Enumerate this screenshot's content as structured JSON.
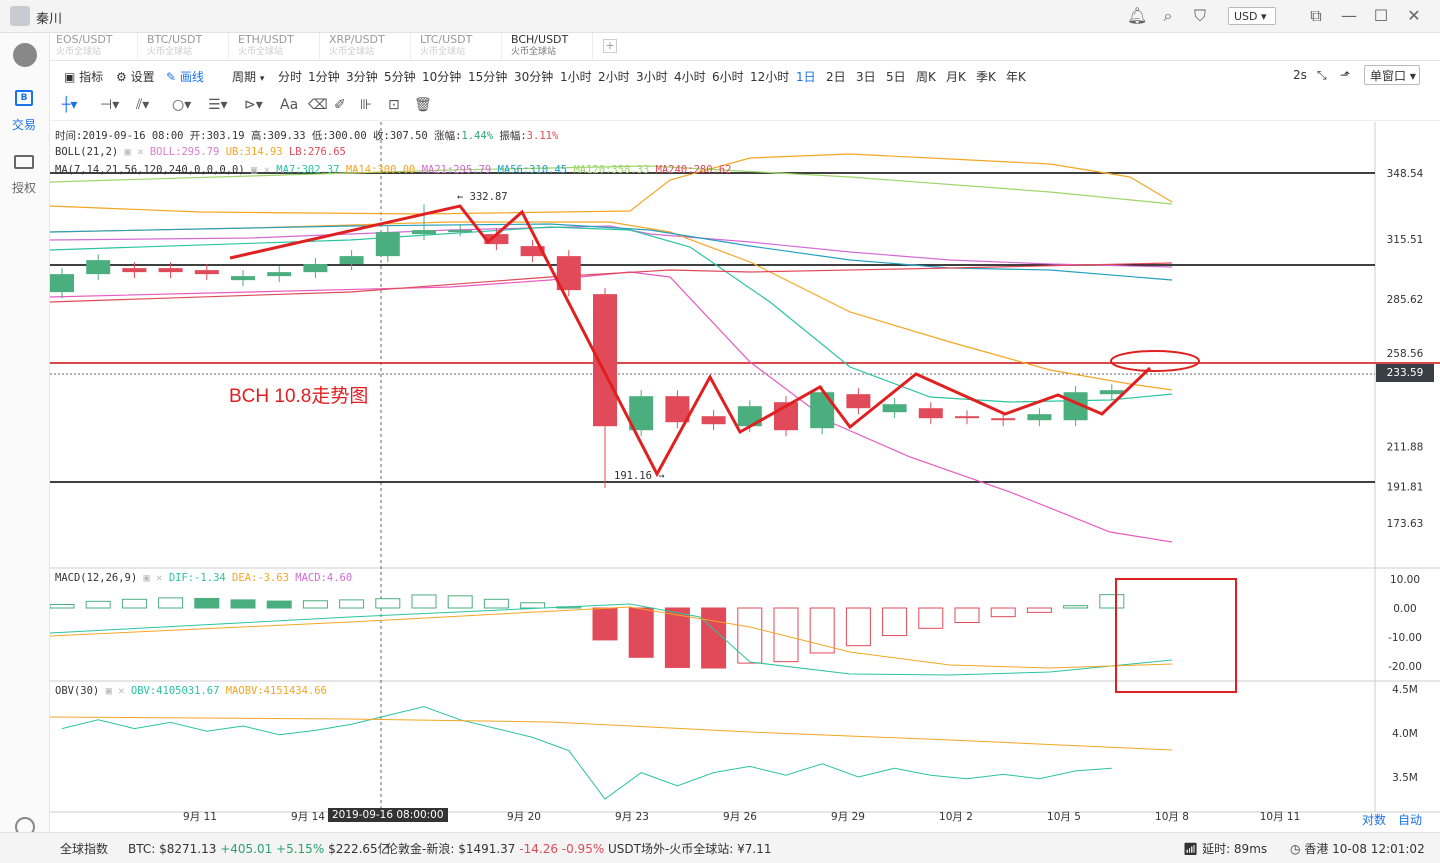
{
  "app": {
    "username": "秦川",
    "currency": "USD"
  },
  "tabs": [
    {
      "label": "EOS/USDT",
      "sub": "火币全球站"
    },
    {
      "label": "BTC/USDT",
      "sub": "火币全球站"
    },
    {
      "label": "ETH/USDT",
      "sub": "火币全球站"
    },
    {
      "label": "XRP/USDT",
      "sub": "火币全球站"
    },
    {
      "label": "LTC/USDT",
      "sub": "火币全球站"
    },
    {
      "label": "BCH/USDT",
      "sub": "火币全球站"
    }
  ],
  "rail": {
    "trade": "交易",
    "auth": "授权"
  },
  "toolbar": {
    "indicator": "指标",
    "settings": "设置",
    "draw": "画线",
    "period": "周期",
    "periods": [
      "分时",
      "1分钟",
      "3分钟",
      "5分钟",
      "10分钟",
      "15分钟",
      "30分钟",
      "1小时",
      "2小时",
      "3小时",
      "4小时",
      "6小时",
      "12小时",
      "1日",
      "2日",
      "3日",
      "5日",
      "周K",
      "月K",
      "季K",
      "年K"
    ],
    "selected_period": "1日",
    "refresh": "2s",
    "window": "单窗口"
  },
  "info": {
    "line1": "时间:2019-09-16 08:00  开:303.19  高:309.33  低:300.00  收:307.50  涨幅:",
    "change": "1.44%",
    "amp_label": "  振幅:",
    "amplitude": "3.11%",
    "boll_label": "BOLL(21,2)",
    "boll": "BOLL:295.79",
    "ub": "UB:314.93",
    "lb": "LB:276.65",
    "ma_label": "MA(7,14,21,56,120,240,0,0,0,0)",
    "ma7": "MA7:302.37",
    "ma14": "MA14:300.00",
    "ma21": "MA21:295.79",
    "ma56": "MA56:310.45",
    "ma120": "MA120:358.33",
    "ma240": "MA240:280.62"
  },
  "macd": {
    "label": "MACD(12,26,9)",
    "dif": "DIF:-1.34",
    "dea": "DEA:-3.63",
    "macd": "MACD:4.60"
  },
  "obv": {
    "label": "OBV(30)",
    "obv": "OBV:4105031.67",
    "maobv": "MAOBV:4151434.66"
  },
  "annotations": {
    "title": "BCH 10.8走势图",
    "high": "332.87",
    "low": "191.16",
    "cursor_date": "2019-09-16 08:00:00",
    "last_price": "233.59"
  },
  "axes": {
    "price_ticks": [
      "348.54",
      "315.51",
      "285.62",
      "258.56",
      "233.59",
      "211.88",
      "191.81",
      "173.63"
    ],
    "macd_ticks": [
      "10.00",
      "0.00",
      "-10.00",
      "-20.00"
    ],
    "obv_ticks": [
      "4.5M",
      "4.0M",
      "3.5M"
    ],
    "date_ticks": [
      "9月 11",
      "9月 14",
      "9月 20",
      "9月 23",
      "9月 26",
      "9月 29",
      "10月 2",
      "10月 5",
      "10月 8",
      "10月 11"
    ],
    "log": "对数",
    "auto": "自动"
  },
  "chart_data": {
    "type": "candlestick",
    "dates": [
      "9/9",
      "9/10",
      "9/11",
      "9/12",
      "9/13",
      "9/14",
      "9/15",
      "9/16",
      "9/17",
      "9/18",
      "9/19",
      "9/20",
      "9/21",
      "9/22",
      "9/23",
      "9/24",
      "9/25",
      "9/26",
      "9/27",
      "9/28",
      "9/29",
      "9/30",
      "10/1",
      "10/2",
      "10/3",
      "10/4",
      "10/5",
      "10/6",
      "10/7",
      "10/8"
    ],
    "open": [
      289,
      298,
      301,
      301,
      300,
      295,
      297,
      299,
      303,
      307,
      318,
      320,
      318,
      312,
      307,
      288,
      220,
      237,
      227,
      222,
      234,
      221,
      238,
      229,
      231,
      227,
      226,
      225,
      225,
      238
    ],
    "close": [
      298,
      305,
      299,
      299,
      298,
      297,
      299,
      303,
      307,
      319,
      320,
      320,
      313,
      307,
      290,
      222,
      237,
      224,
      223,
      232,
      220,
      239,
      231,
      233,
      226,
      226,
      225,
      228,
      239,
      240
    ],
    "colors": {
      "up": "#4bae7f",
      "down": "#e04a59",
      "ub": "#f5a623",
      "boll": "#d97ccc",
      "ma56": "#26a0bf"
    },
    "macd_hist": [
      1.2,
      2.3,
      3.0,
      3.5,
      3.3,
      2.8,
      2.4,
      2.5,
      2.8,
      3.2,
      4.5,
      4.2,
      3.0,
      1.8,
      0.4,
      -11,
      -17,
      -20.5,
      -20.7,
      -19,
      -18.5,
      -15.5,
      -13,
      -9.5,
      -7,
      -5,
      -3,
      -1.5,
      0.8,
      4.6
    ],
    "obv": [
      4.05,
      4.15,
      4.05,
      4.12,
      4.02,
      4.08,
      3.98,
      4.03,
      4.1,
      4.2,
      4.3,
      4.15,
      4.05,
      3.95,
      3.8,
      3.25,
      3.55,
      3.4,
      3.55,
      3.62,
      3.52,
      3.65,
      3.5,
      3.6,
      3.52,
      3.48,
      3.53,
      3.48,
      3.57,
      3.6
    ]
  },
  "status": {
    "index": "全球指数",
    "btc_label": "BTC: $8271.13",
    "btc_change": "+405.01 +5.15%",
    "btc_cap": "$222.65亿",
    "gold_label": "伦敦金-新浪: $1491.37",
    "gold_change": "-14.26 -0.95%",
    "usdt": "USDT场外-火币全球站: ¥7.11",
    "latency": "延时: 89ms",
    "time": "香港 10-08 12:01:02"
  }
}
